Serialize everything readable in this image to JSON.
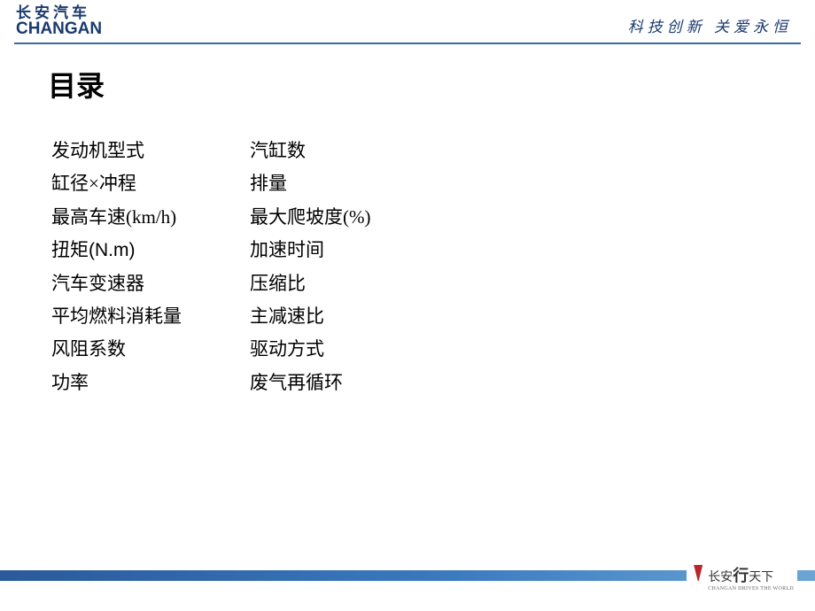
{
  "header": {
    "logo_cn": "长安汽车",
    "logo_en": "CHANGAN",
    "slogan": "科技创新 关爱永恒"
  },
  "title": "目录",
  "toc": {
    "left": [
      "发动机型式",
      "缸径×冲程",
      "最高车速(km/h)",
      "扭矩(N.m)",
      "汽车变速器",
      "平均燃料消耗量",
      "风阻系数",
      "功率"
    ],
    "right": [
      "汽缸数",
      "排量",
      "最大爬坡度(%)",
      "加速时间",
      "压缩比",
      "主减速比",
      "驱动方式",
      "废气再循环"
    ]
  },
  "footer": {
    "cn_prefix": "长安",
    "cn_script": "行",
    "cn_suffix": "天下",
    "en": "CHANGAN DRIVES THE WORLD"
  }
}
